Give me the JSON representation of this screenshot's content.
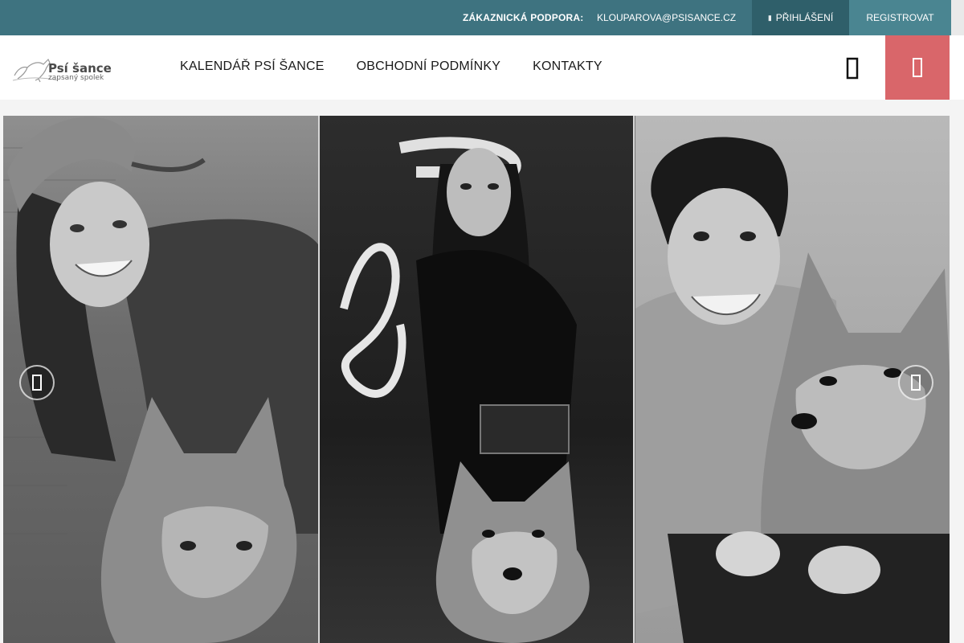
{
  "topbar": {
    "support_label": "ZÁKAZNICKÁ PODPORA:",
    "support_email": "KLOUPAROVA@PSISANCE.CZ",
    "login_label": "PŘIHLÁŠENÍ",
    "register_label": "REGISTROVAT"
  },
  "header": {
    "logo_name": "Psí šance",
    "logo_sub": "zapsaný spolek",
    "nav": [
      {
        "label": "KALENDÁŘ PSÍ ŠANCE"
      },
      {
        "label": "OBCHODNÍ PODMÍNKY"
      },
      {
        "label": "KONTAKTY"
      }
    ]
  },
  "hero": {
    "panels": [
      "woman-with-cap-and-dog",
      "woman-in-black-with-dog",
      "man-with-dog"
    ]
  },
  "colors": {
    "topbar": "#3e7380",
    "login": "#2f5f6a",
    "register": "#4a8591",
    "cart": "#d9666a"
  },
  "icons": {
    "login": "user-icon",
    "search": "search-icon",
    "cart": "cart-icon",
    "prev": "chevron-left-icon",
    "next": "chevron-right-icon"
  }
}
